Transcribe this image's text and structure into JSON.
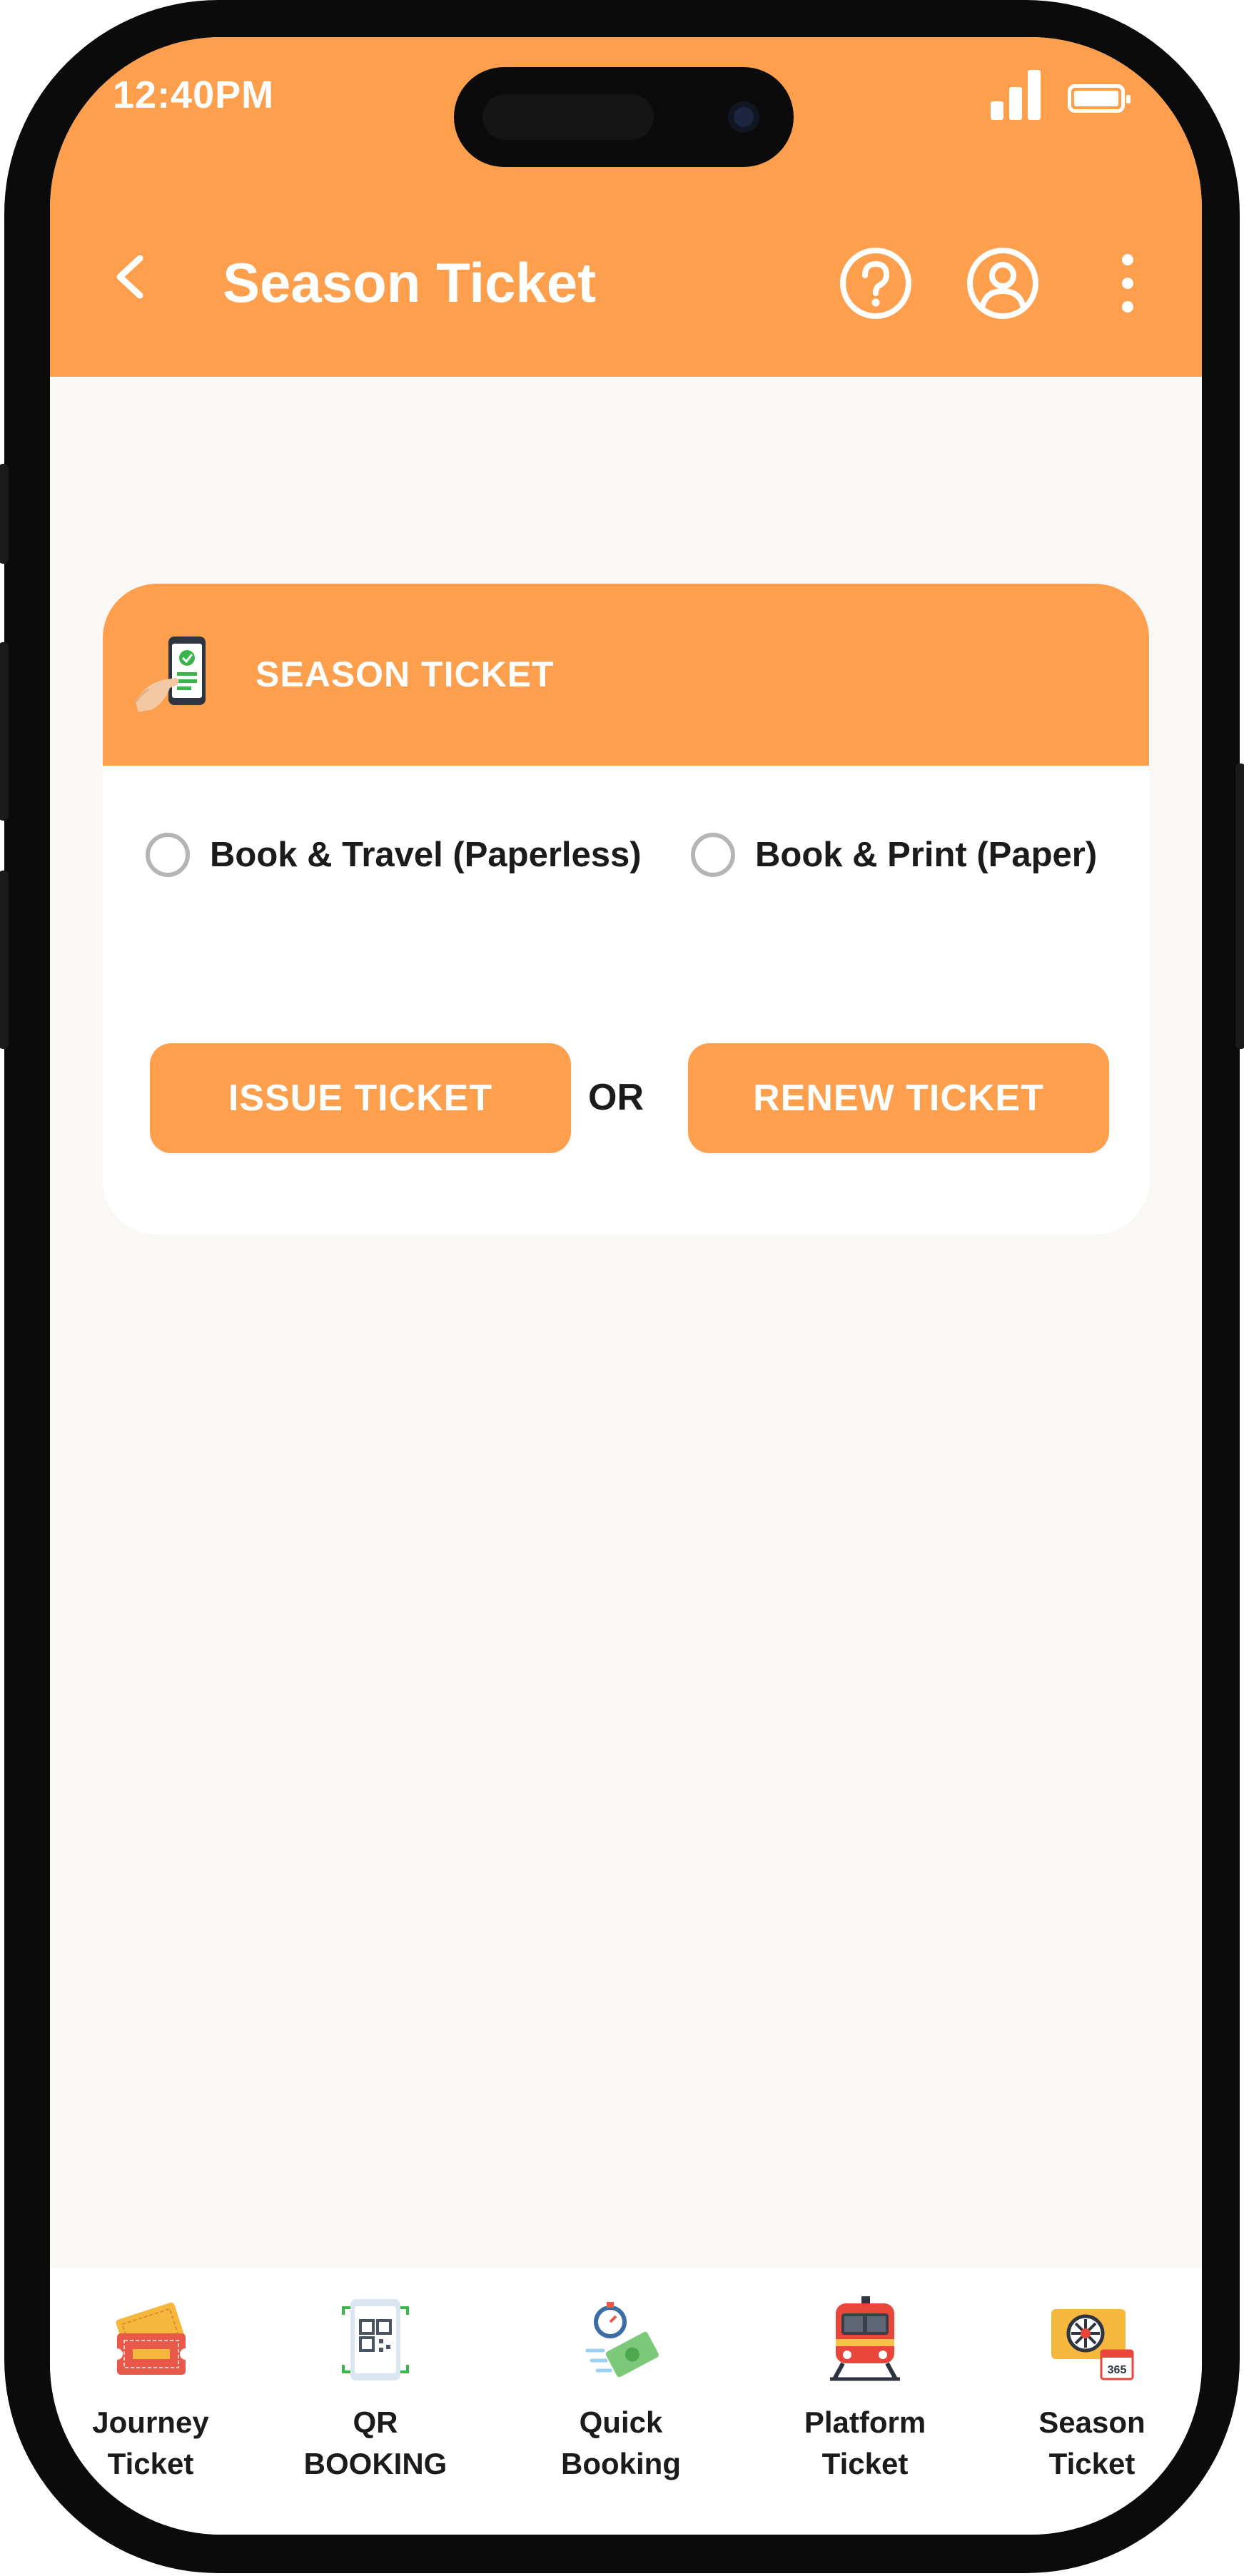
{
  "status_bar": {
    "time": "12:40PM",
    "icons": [
      "signal-icon",
      "battery-icon"
    ]
  },
  "header": {
    "title": "Season Ticket",
    "icons": [
      "back-arrow-icon",
      "help-icon",
      "profile-icon",
      "more-vert-icon"
    ]
  },
  "card": {
    "title": "SEASON TICKET",
    "icon": "mobile-ticket-icon",
    "options": [
      {
        "label": "Book & Travel (Paperless)",
        "selected": false
      },
      {
        "label": "Book & Print (Paper)",
        "selected": false
      }
    ],
    "issue_label": "ISSUE TICKET",
    "or_label": "OR",
    "renew_label": "RENEW TICKET"
  },
  "bottom_nav": {
    "items": [
      {
        "label": "Journey\nTicket",
        "icon": "journey-ticket-icon"
      },
      {
        "label": "QR\nBOOKING",
        "icon": "qr-booking-icon"
      },
      {
        "label": "Quick\nBooking",
        "icon": "quick-booking-icon"
      },
      {
        "label": "Platform\nTicket",
        "icon": "platform-ticket-icon"
      },
      {
        "label": "Season\nTicket",
        "icon": "season-ticket-icon",
        "badge": "365"
      }
    ]
  },
  "colors": {
    "accent": "#fd9f4c",
    "background": "#f9f8f5",
    "text": "#1b1b1b"
  }
}
